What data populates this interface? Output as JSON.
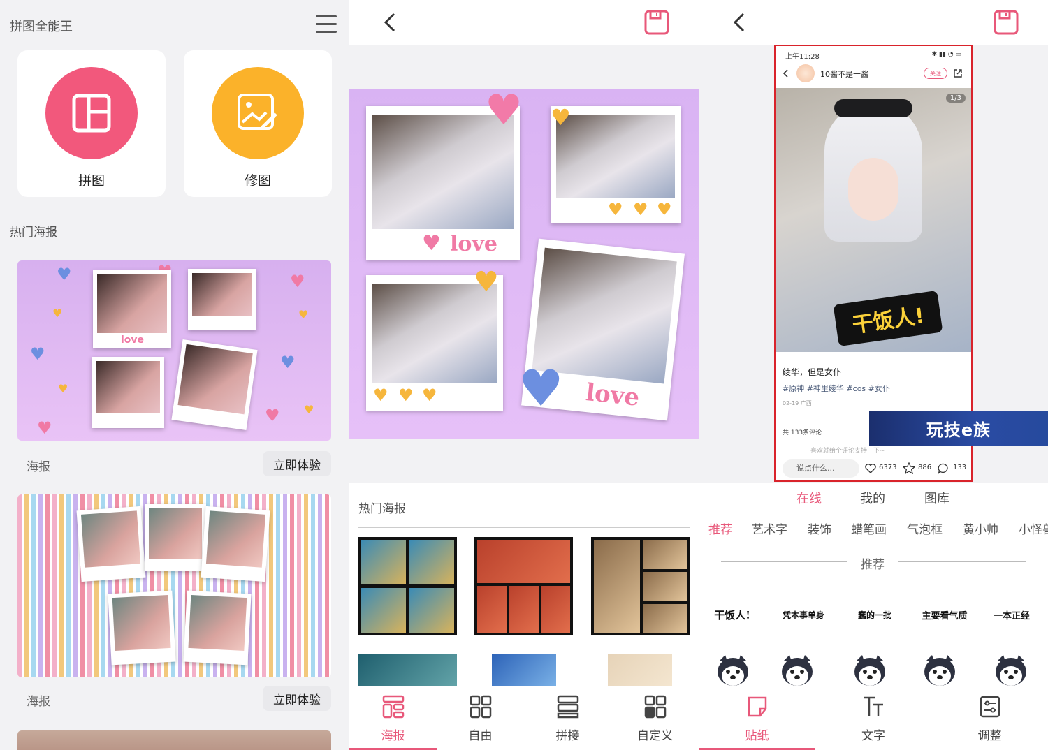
{
  "panel1": {
    "app_title": "拼图全能王",
    "tools": [
      {
        "label": "拼图",
        "color": "#f2587c",
        "icon": "collage-grid-icon"
      },
      {
        "label": "修图",
        "color": "#fbb22a",
        "icon": "photo-edit-icon"
      }
    ],
    "section_title": "热门海报",
    "posters": [
      {
        "caption": "海报",
        "button": "立即体验",
        "sticker_text": "love"
      },
      {
        "caption": "海报",
        "button": "立即体验"
      }
    ]
  },
  "panel2": {
    "canvas_text": [
      "love",
      "love"
    ],
    "templates_title": "热门海报",
    "nav": [
      {
        "label": "海报",
        "active": true,
        "icon": "poster-layout-icon"
      },
      {
        "label": "自由",
        "active": false,
        "icon": "free-grid-icon"
      },
      {
        "label": "拼接",
        "active": false,
        "icon": "stitch-icon"
      },
      {
        "label": "自定义",
        "active": false,
        "icon": "custom-grid-icon"
      }
    ]
  },
  "panel3": {
    "phone": {
      "status_time": "上午11:28",
      "username": "10酱不是十酱",
      "follow": "关注",
      "page_indicator": "1/3",
      "sticker_overlay": "干饭人!",
      "post_title": "绫华，但是女仆",
      "tags": "#原神 #神里绫华 #cos #女仆",
      "date": "02-19 广西",
      "comment_count": "共 133条评论",
      "comment_hint": "喜欢就给个评论支持一下~",
      "say_placeholder": "说点什么...",
      "likes": "6373",
      "stars": "886",
      "comments": "133"
    },
    "brand_banner": "玩技e族",
    "source_tabs": [
      {
        "label": "在线",
        "active": true
      },
      {
        "label": "我的",
        "active": false
      },
      {
        "label": "图库",
        "active": false
      }
    ],
    "categories": [
      {
        "label": "推荐",
        "active": true
      },
      {
        "label": "艺术字",
        "active": false
      },
      {
        "label": "装饰",
        "active": false
      },
      {
        "label": "蜡笔画",
        "active": false
      },
      {
        "label": "气泡框",
        "active": false
      },
      {
        "label": "黄小帅",
        "active": false
      },
      {
        "label": "小怪兽",
        "active": false
      }
    ],
    "divider_label": "推荐",
    "stickers": [
      "干饭人!",
      "凭本事单身",
      "蠢的一批",
      "主要看气质",
      "一本正经"
    ],
    "nav": [
      {
        "label": "贴纸",
        "active": true,
        "icon": "sticker-icon"
      },
      {
        "label": "文字",
        "active": false,
        "icon": "text-icon"
      },
      {
        "label": "调整",
        "active": false,
        "icon": "adjust-icon"
      }
    ]
  }
}
